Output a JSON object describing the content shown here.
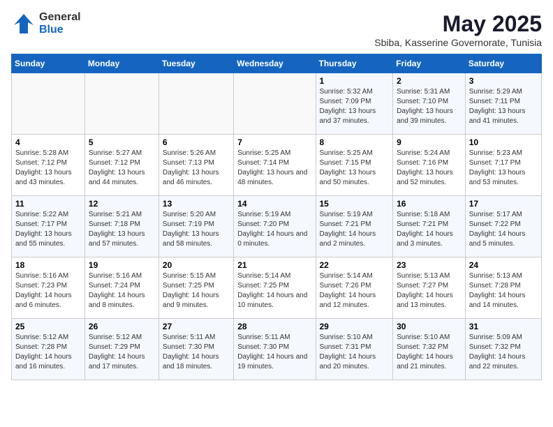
{
  "logo": {
    "general": "General",
    "blue": "Blue"
  },
  "title": "May 2025",
  "subtitle": "Sbiba, Kasserine Governorate, Tunisia",
  "headers": [
    "Sunday",
    "Monday",
    "Tuesday",
    "Wednesday",
    "Thursday",
    "Friday",
    "Saturday"
  ],
  "weeks": [
    [
      {
        "day": "",
        "sunrise": "",
        "sunset": "",
        "daylight": ""
      },
      {
        "day": "",
        "sunrise": "",
        "sunset": "",
        "daylight": ""
      },
      {
        "day": "",
        "sunrise": "",
        "sunset": "",
        "daylight": ""
      },
      {
        "day": "",
        "sunrise": "",
        "sunset": "",
        "daylight": ""
      },
      {
        "day": "1",
        "sunrise": "Sunrise: 5:32 AM",
        "sunset": "Sunset: 7:09 PM",
        "daylight": "Daylight: 13 hours and 37 minutes."
      },
      {
        "day": "2",
        "sunrise": "Sunrise: 5:31 AM",
        "sunset": "Sunset: 7:10 PM",
        "daylight": "Daylight: 13 hours and 39 minutes."
      },
      {
        "day": "3",
        "sunrise": "Sunrise: 5:29 AM",
        "sunset": "Sunset: 7:11 PM",
        "daylight": "Daylight: 13 hours and 41 minutes."
      }
    ],
    [
      {
        "day": "4",
        "sunrise": "Sunrise: 5:28 AM",
        "sunset": "Sunset: 7:12 PM",
        "daylight": "Daylight: 13 hours and 43 minutes."
      },
      {
        "day": "5",
        "sunrise": "Sunrise: 5:27 AM",
        "sunset": "Sunset: 7:12 PM",
        "daylight": "Daylight: 13 hours and 44 minutes."
      },
      {
        "day": "6",
        "sunrise": "Sunrise: 5:26 AM",
        "sunset": "Sunset: 7:13 PM",
        "daylight": "Daylight: 13 hours and 46 minutes."
      },
      {
        "day": "7",
        "sunrise": "Sunrise: 5:25 AM",
        "sunset": "Sunset: 7:14 PM",
        "daylight": "Daylight: 13 hours and 48 minutes."
      },
      {
        "day": "8",
        "sunrise": "Sunrise: 5:25 AM",
        "sunset": "Sunset: 7:15 PM",
        "daylight": "Daylight: 13 hours and 50 minutes."
      },
      {
        "day": "9",
        "sunrise": "Sunrise: 5:24 AM",
        "sunset": "Sunset: 7:16 PM",
        "daylight": "Daylight: 13 hours and 52 minutes."
      },
      {
        "day": "10",
        "sunrise": "Sunrise: 5:23 AM",
        "sunset": "Sunset: 7:17 PM",
        "daylight": "Daylight: 13 hours and 53 minutes."
      }
    ],
    [
      {
        "day": "11",
        "sunrise": "Sunrise: 5:22 AM",
        "sunset": "Sunset: 7:17 PM",
        "daylight": "Daylight: 13 hours and 55 minutes."
      },
      {
        "day": "12",
        "sunrise": "Sunrise: 5:21 AM",
        "sunset": "Sunset: 7:18 PM",
        "daylight": "Daylight: 13 hours and 57 minutes."
      },
      {
        "day": "13",
        "sunrise": "Sunrise: 5:20 AM",
        "sunset": "Sunset: 7:19 PM",
        "daylight": "Daylight: 13 hours and 58 minutes."
      },
      {
        "day": "14",
        "sunrise": "Sunrise: 5:19 AM",
        "sunset": "Sunset: 7:20 PM",
        "daylight": "Daylight: 14 hours and 0 minutes."
      },
      {
        "day": "15",
        "sunrise": "Sunrise: 5:19 AM",
        "sunset": "Sunset: 7:21 PM",
        "daylight": "Daylight: 14 hours and 2 minutes."
      },
      {
        "day": "16",
        "sunrise": "Sunrise: 5:18 AM",
        "sunset": "Sunset: 7:21 PM",
        "daylight": "Daylight: 14 hours and 3 minutes."
      },
      {
        "day": "17",
        "sunrise": "Sunrise: 5:17 AM",
        "sunset": "Sunset: 7:22 PM",
        "daylight": "Daylight: 14 hours and 5 minutes."
      }
    ],
    [
      {
        "day": "18",
        "sunrise": "Sunrise: 5:16 AM",
        "sunset": "Sunset: 7:23 PM",
        "daylight": "Daylight: 14 hours and 6 minutes."
      },
      {
        "day": "19",
        "sunrise": "Sunrise: 5:16 AM",
        "sunset": "Sunset: 7:24 PM",
        "daylight": "Daylight: 14 hours and 8 minutes."
      },
      {
        "day": "20",
        "sunrise": "Sunrise: 5:15 AM",
        "sunset": "Sunset: 7:25 PM",
        "daylight": "Daylight: 14 hours and 9 minutes."
      },
      {
        "day": "21",
        "sunrise": "Sunrise: 5:14 AM",
        "sunset": "Sunset: 7:25 PM",
        "daylight": "Daylight: 14 hours and 10 minutes."
      },
      {
        "day": "22",
        "sunrise": "Sunrise: 5:14 AM",
        "sunset": "Sunset: 7:26 PM",
        "daylight": "Daylight: 14 hours and 12 minutes."
      },
      {
        "day": "23",
        "sunrise": "Sunrise: 5:13 AM",
        "sunset": "Sunset: 7:27 PM",
        "daylight": "Daylight: 14 hours and 13 minutes."
      },
      {
        "day": "24",
        "sunrise": "Sunrise: 5:13 AM",
        "sunset": "Sunset: 7:28 PM",
        "daylight": "Daylight: 14 hours and 14 minutes."
      }
    ],
    [
      {
        "day": "25",
        "sunrise": "Sunrise: 5:12 AM",
        "sunset": "Sunset: 7:28 PM",
        "daylight": "Daylight: 14 hours and 16 minutes."
      },
      {
        "day": "26",
        "sunrise": "Sunrise: 5:12 AM",
        "sunset": "Sunset: 7:29 PM",
        "daylight": "Daylight: 14 hours and 17 minutes."
      },
      {
        "day": "27",
        "sunrise": "Sunrise: 5:11 AM",
        "sunset": "Sunset: 7:30 PM",
        "daylight": "Daylight: 14 hours and 18 minutes."
      },
      {
        "day": "28",
        "sunrise": "Sunrise: 5:11 AM",
        "sunset": "Sunset: 7:30 PM",
        "daylight": "Daylight: 14 hours and 19 minutes."
      },
      {
        "day": "29",
        "sunrise": "Sunrise: 5:10 AM",
        "sunset": "Sunset: 7:31 PM",
        "daylight": "Daylight: 14 hours and 20 minutes."
      },
      {
        "day": "30",
        "sunrise": "Sunrise: 5:10 AM",
        "sunset": "Sunset: 7:32 PM",
        "daylight": "Daylight: 14 hours and 21 minutes."
      },
      {
        "day": "31",
        "sunrise": "Sunrise: 5:09 AM",
        "sunset": "Sunset: 7:32 PM",
        "daylight": "Daylight: 14 hours and 22 minutes."
      }
    ]
  ]
}
